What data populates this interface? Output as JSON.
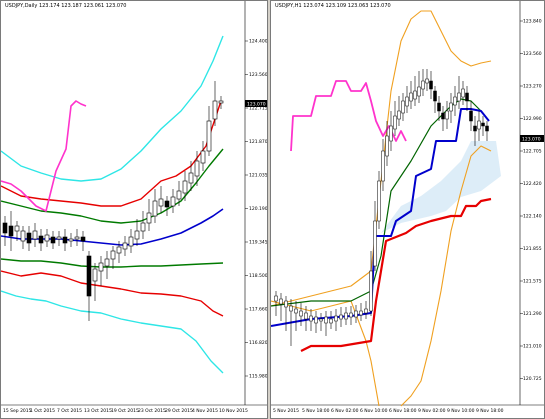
{
  "left_chart": {
    "title": "USDJPY,Daily 123.174 123.187 123.061 123.070",
    "price_badge": "123.070",
    "y_labels": [
      "124.400",
      "123.560",
      "122.715",
      "121.870",
      "121.035",
      "120.190",
      "119.345",
      "118.500",
      "117.660",
      "116.820",
      "115.980"
    ],
    "x_labels": [
      "15 Sep 2015",
      "1 Oct 2015",
      "7 Oct 2015",
      "13 Oct 2015",
      "19 Oct 2015",
      "23 Oct 2015",
      "29 Oct 2015",
      "4 Nov 2015",
      "10 Nov 2015"
    ]
  },
  "right_chart": {
    "title": "USDJPY,H1 123.074 123.109 123.063 123.070",
    "price_badge": "123.070",
    "y_labels": [
      "123.840",
      "123.560",
      "123.270",
      "122.990",
      "122.705",
      "122.420",
      "122.140",
      "121.855",
      "121.575",
      "121.290",
      "121.010",
      "120.725"
    ],
    "x_labels": [
      "5 Nov 2015",
      "5 Nov 18:00",
      "6 Nov 02:00",
      "6 Nov 10:00",
      "6 Nov 18:00",
      "9 Nov 02:00",
      "9 Nov 10:00",
      "9 Nov 18:00"
    ]
  },
  "colors": {
    "cyan": "#2ee6e6",
    "red": "#e60000",
    "green": "#007a00",
    "blue": "#0000cc",
    "magenta": "#ff33cc",
    "orange": "#f0a020",
    "darkgreen": "#006400",
    "candle": "#000000"
  }
}
